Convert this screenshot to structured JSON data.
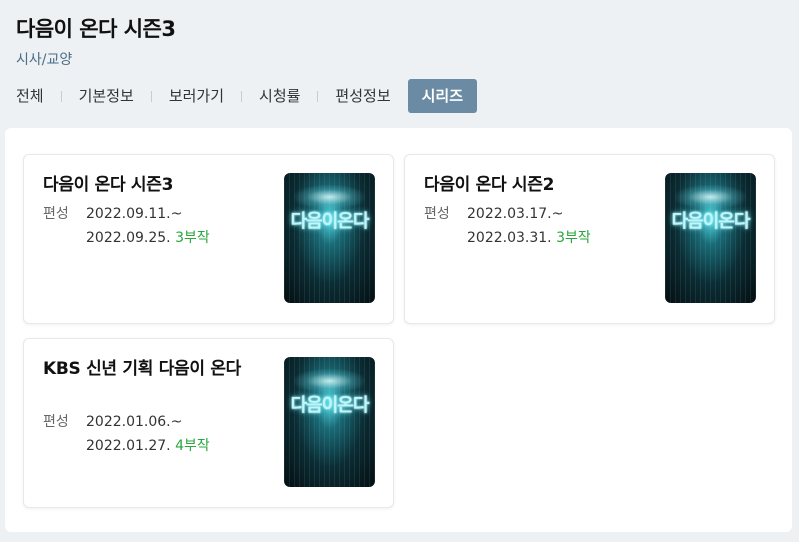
{
  "header": {
    "title": "다음이 온다 시즌3",
    "genre": "시사/교양"
  },
  "tabs": [
    {
      "label": "전체"
    },
    {
      "label": "기본정보"
    },
    {
      "label": "보러가기"
    },
    {
      "label": "시청률"
    },
    {
      "label": "편성정보"
    },
    {
      "label": "시리즈",
      "active": true
    }
  ],
  "series": [
    {
      "title": "다음이 온다 시즌3",
      "meta_label": "편성",
      "start": "2022.09.11.~",
      "end": "2022.09.25.",
      "episodes": "3부작",
      "poster_logo": "다음이온다"
    },
    {
      "title": "다음이 온다 시즌2",
      "meta_label": "편성",
      "start": "2022.03.17.~",
      "end": "2022.03.31.",
      "episodes": "3부작",
      "poster_logo": "다음이온다"
    },
    {
      "title": "KBS 신년 기획 다음이 온다",
      "meta_label": "편성",
      "start": "2022.01.06.~",
      "end": "2022.01.27.",
      "episodes": "4부작",
      "poster_logo": "다음이온다"
    }
  ],
  "colors": {
    "active_tab": "#6a8ba3",
    "episode_count": "#2aa73c",
    "genre": "#4a6c86"
  }
}
